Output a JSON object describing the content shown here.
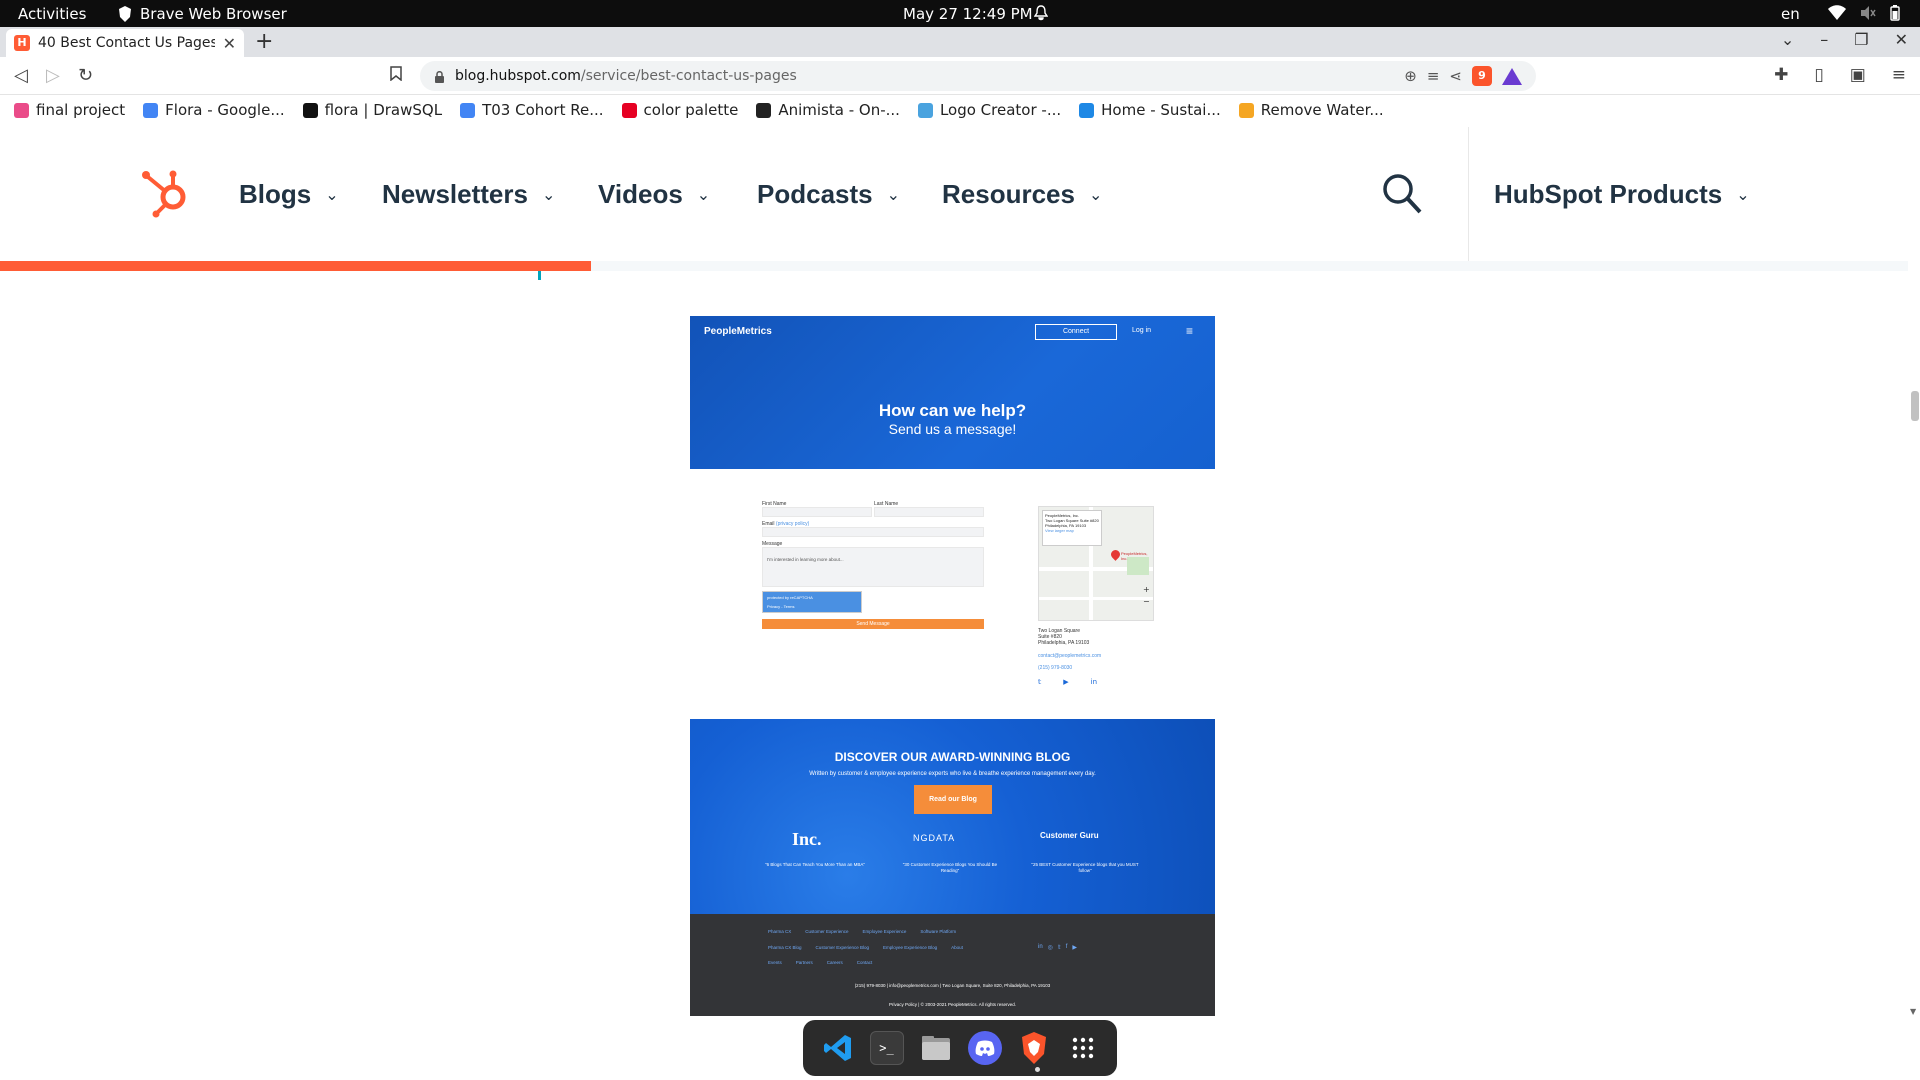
{
  "system_bar": {
    "activities": "Activities",
    "app_name": "Brave Web Browser",
    "clock": "May 27  12:49 PM",
    "language": "en"
  },
  "browser": {
    "tab_title": "40 Best Contact Us Pages",
    "url_host": "blog.hubspot.com",
    "url_path": "/service/best-contact-us-pages",
    "shield_count": "9",
    "bookmarks": [
      {
        "label": "final project",
        "icon": "dribbble-icon",
        "color": "#ea4c89"
      },
      {
        "label": "Flora - Google...",
        "icon": "google-docs-icon",
        "color": "#4285f4"
      },
      {
        "label": "flora | DrawSQL",
        "icon": "drawsql-icon",
        "color": "#111111"
      },
      {
        "label": "T03 Cohort Re...",
        "icon": "google-docs-icon",
        "color": "#4285f4"
      },
      {
        "label": "color palette",
        "icon": "pinterest-icon",
        "color": "#e60023"
      },
      {
        "label": "Animista - On-...",
        "icon": "animista-icon",
        "color": "#222222"
      },
      {
        "label": "Logo Creator -...",
        "icon": "logo-creator-icon",
        "color": "#4aa3df"
      },
      {
        "label": "Home - Sustai...",
        "icon": "home-sustain-icon",
        "color": "#1e88e5"
      },
      {
        "label": "Remove Water...",
        "icon": "remove-watermark-icon",
        "color": "#f5a623"
      }
    ]
  },
  "hubspot": {
    "nav": [
      {
        "label": "Blogs"
      },
      {
        "label": "Newsletters"
      },
      {
        "label": "Videos"
      },
      {
        "label": "Podcasts"
      },
      {
        "label": "Resources"
      }
    ],
    "products": "HubSpot Products",
    "brand_color": "#ff5c35",
    "reading_progress": 0.31
  },
  "article_image": {
    "hero": {
      "logo": "PeopleMetrics",
      "connect": "Connect",
      "login": "Log in",
      "heading": "How can we help?",
      "subheading": "Send us a message!"
    },
    "form": {
      "first_name": "First Name",
      "last_name": "Last Name",
      "email": "Email",
      "privacy": "(privacy policy)",
      "message": "Message",
      "message_text": "I'm interested in learning more about...",
      "captcha": "protected by reCAPTCHA",
      "captcha_sub": "Privacy - Terms",
      "send": "Send Message"
    },
    "map_card": {
      "name": "PeopleMetrics, Inc.",
      "street": "Two Logan Square Suite #820",
      "city": "Philadelphia, PA 19103",
      "link": "View larger map",
      "pin_label": "PeopleMetrics, Inc."
    },
    "contact": {
      "address": "Two Logan Square\nSuite #820\nPhiladelphia, PA 19103",
      "email": "contact@peoplemetrics.com",
      "phone": "(215) 979-8030"
    },
    "blog_banner": {
      "title": "DISCOVER OUR AWARD-WINNING BLOG",
      "subtitle": "Written by customer & employee experience experts who live & breathe experience management every day.",
      "button": "Read our Blog",
      "logos": [
        {
          "name": "Inc.",
          "quote": "\"6 Blogs That Can Teach You More Than an MBA\""
        },
        {
          "name": "NGDATA",
          "quote": "\"30 Customer Experience Blogs You Should Be Reading\""
        },
        {
          "name": "Customer Guru",
          "quote": "\"25 BEST Customer Experience blogs that you MUST follow\""
        }
      ]
    },
    "footer": {
      "row1": [
        "Pharma CX",
        "Customer Experience",
        "Employee Experience",
        "Software Platform"
      ],
      "row2": [
        "Pharma CX Blog",
        "Customer Experience Blog",
        "Employee Experience Blog",
        "About"
      ],
      "row3": [
        "Events",
        "Partners",
        "Careers",
        "Contact"
      ],
      "contact_line": "(215) 979-8030  |  info@peoplemetrics.com  |  Two Logan Square, Suite 820, Philadelphia, PA 19103",
      "legal": "Privacy Policy  |  © 2003-2021 PeopleMetrics. All rights reserved."
    }
  },
  "dock": [
    "vscode-icon",
    "terminal-icon",
    "files-icon",
    "discord-icon",
    "brave-icon",
    "app-grid-icon"
  ]
}
